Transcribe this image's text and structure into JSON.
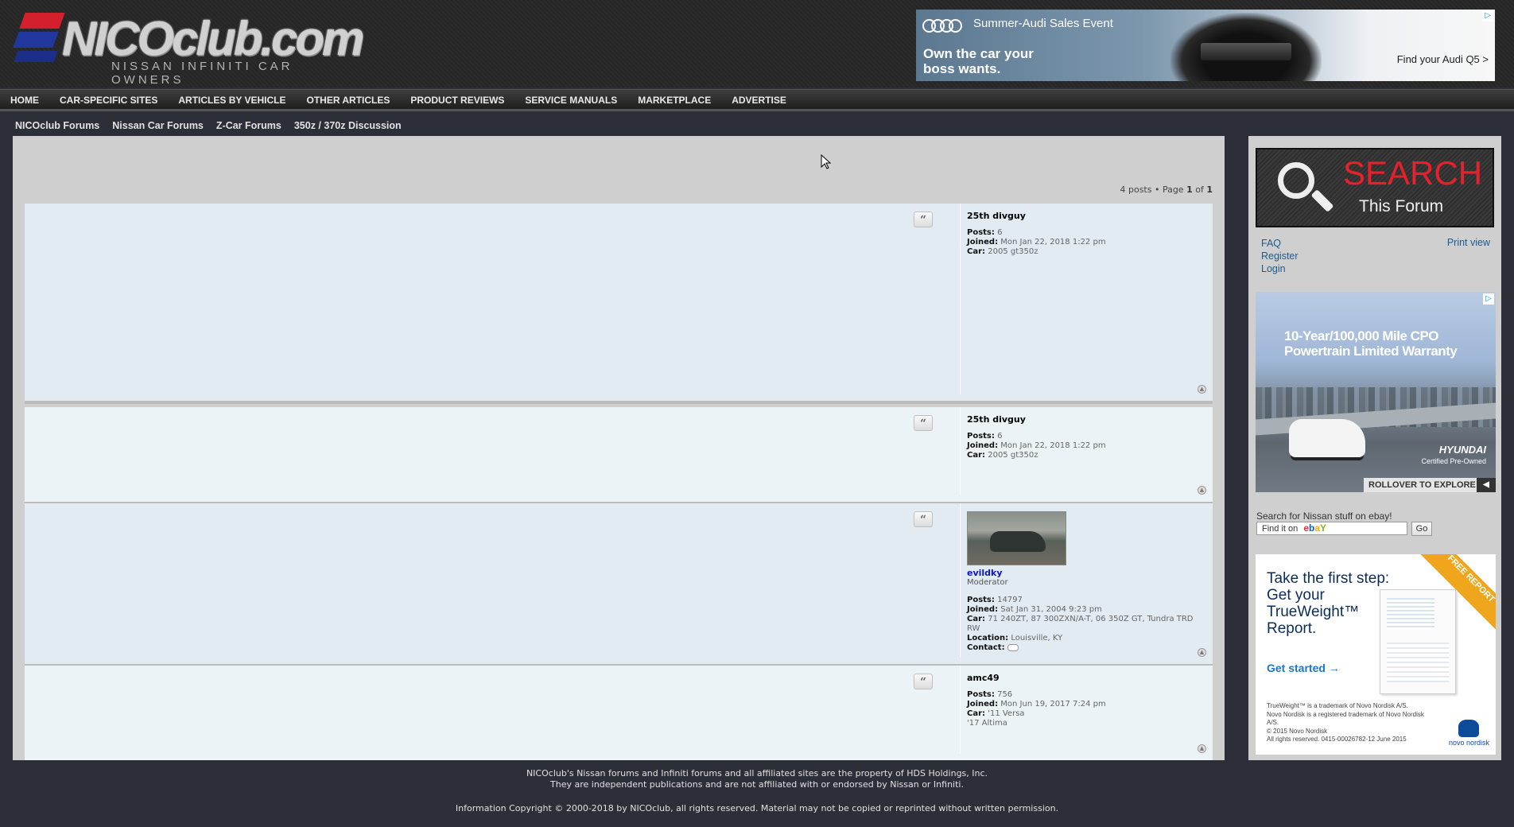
{
  "header": {
    "logo_main": "NICOclub.com",
    "logo_sub": "NISSAN INFINITI CAR OWNERS",
    "ad": {
      "headline": "Summer-Audi Sales Event",
      "tagline": "Own the car your boss wants.",
      "cta": "Find your Audi Q5 >"
    }
  },
  "nav": {
    "items": [
      "HOME",
      "CAR-SPECIFIC SITES",
      "ARTICLES BY VEHICLE",
      "OTHER ARTICLES",
      "PRODUCT REVIEWS",
      "SERVICE MANUALS",
      "MARKETPLACE",
      "ADVERTISE"
    ]
  },
  "breadcrumb": [
    "NICOclub Forums",
    "Nissan Car Forums",
    "Z-Car Forums",
    "350z / 370z Discussion"
  ],
  "pagination": {
    "text": "4 posts • Page",
    "current": "1",
    "of": "of",
    "total": "1"
  },
  "posts": [
    {
      "author": "25th divguy",
      "posts_label": "Posts:",
      "posts": "6",
      "joined_label": "Joined:",
      "joined": "Mon Jan 22, 2018 1:22 pm",
      "car_label": "Car:",
      "car": "2005 gt350z"
    },
    {
      "author": "25th divguy",
      "posts_label": "Posts:",
      "posts": "6",
      "joined_label": "Joined:",
      "joined": "Mon Jan 22, 2018 1:22 pm",
      "car_label": "Car:",
      "car": "2005 gt350z"
    },
    {
      "author": "evildky",
      "rank": "Moderator",
      "posts_label": "Posts:",
      "posts": "14797",
      "joined_label": "Joined:",
      "joined": "Sat Jan 31, 2004 9:23 pm",
      "car_label": "Car:",
      "car": "71 240ZT, 87 300ZXN/A-T, 06 350Z GT, Tundra TRD RW",
      "location_label": "Location:",
      "location": "Louisville, KY",
      "contact_label": "Contact:"
    },
    {
      "author": "amc49",
      "posts_label": "Posts:",
      "posts": "756",
      "joined_label": "Joined:",
      "joined": "Mon Jun 19, 2017 7:24 pm",
      "car_label": "Car:",
      "car": "'11 Versa",
      "car2": "'17 Altima"
    }
  ],
  "quote_glyph": "“",
  "top_glyph": "▲",
  "sidebar": {
    "search_title": "SEARCH",
    "search_sub": "This Forum",
    "links": [
      "FAQ",
      "Register",
      "Login"
    ],
    "print_view": "Print view",
    "hyundai_ad": {
      "headline": "10-Year/100,000 Mile CPO Powertrain Limited Warranty",
      "brand": "HYUNDAI",
      "brand_sub": "Certified Pre-Owned",
      "rollover": "ROLLOVER TO EXPLORE"
    },
    "ebay_label": "Search for Nissan stuff on ebay!",
    "ebay_box_prefix": "Find it on",
    "ebay_letters": [
      "e",
      "b",
      "a",
      "Y"
    ],
    "ebay_go": "Go",
    "trueweight_ad": {
      "ribbon": "FREE REPORT",
      "headline": "Take the first step: Get your TrueWeight™ Report.",
      "cta": "Get started →",
      "legal": [
        "TrueWeight™ is a trademark of Novo Nordisk A/S.",
        "Novo Nordisk is a registered trademark of Novo Nordisk A/S.",
        "© 2015 Novo Nordisk",
        "All rights reserved. 0415-00026782-12 June 2015"
      ],
      "brand": "novo nordisk"
    }
  },
  "footer": {
    "line1": "NICOclub's Nissan forums and Infiniti forums and all affiliated sites are the property of HDS Holdings, Inc.",
    "line2": "They are independent publications and are not affiliated with or endorsed by Nissan or Infiniti.",
    "line3": "Information Copyright © 2000-2018 by NICOclub, all rights reserved. Material may not be copied or reprinted without written permission."
  }
}
